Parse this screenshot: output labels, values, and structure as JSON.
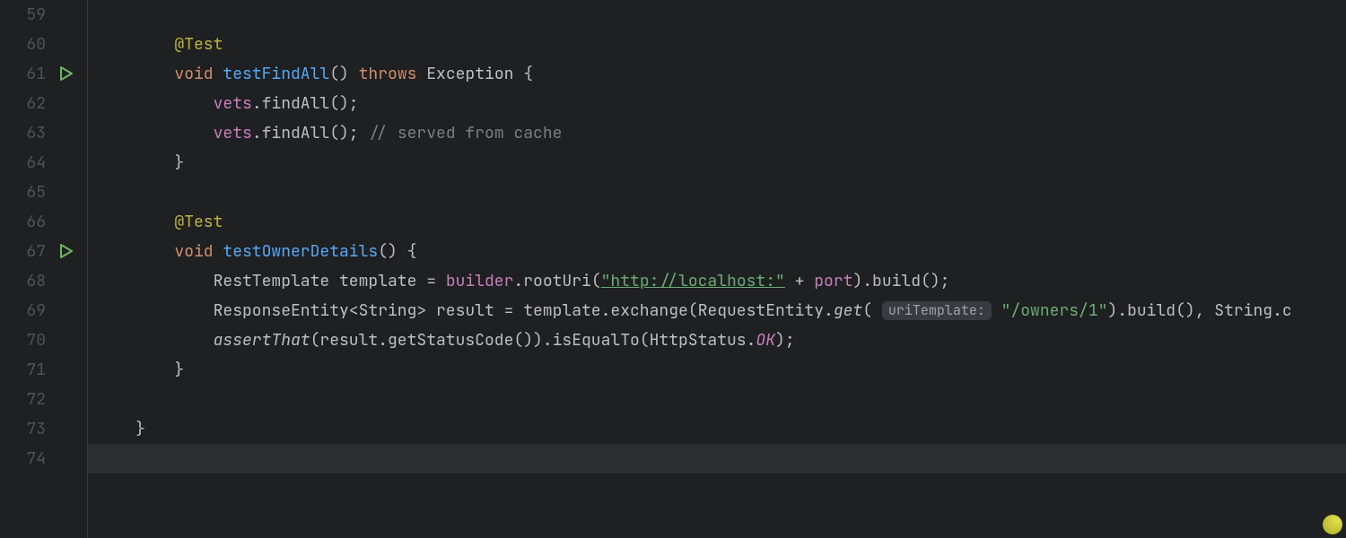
{
  "gutter": {
    "start": 59,
    "end": 74,
    "runnable_lines": [
      61,
      67
    ]
  },
  "current_line": 74,
  "code": {
    "59": [],
    "60": [
      {
        "indent": 8,
        "cls": "tk-annotation",
        "text": "@Test"
      }
    ],
    "61": [
      {
        "indent": 8,
        "cls": "tk-keyword",
        "text": "void "
      },
      {
        "cls": "tk-methoddecl",
        "text": "testFindAll"
      },
      {
        "cls": "tk-default",
        "text": "() "
      },
      {
        "cls": "tk-keyword",
        "text": "throws "
      },
      {
        "cls": "tk-type",
        "text": "Exception {"
      }
    ],
    "62": [
      {
        "indent": 12,
        "cls": "tk-field",
        "text": "vets"
      },
      {
        "cls": "tk-default",
        "text": ".findAll();"
      }
    ],
    "63": [
      {
        "indent": 12,
        "cls": "tk-field",
        "text": "vets"
      },
      {
        "cls": "tk-default",
        "text": ".findAll(); "
      },
      {
        "cls": "tk-comment",
        "text": "// served from cache"
      }
    ],
    "64": [
      {
        "indent": 8,
        "cls": "tk-default",
        "text": "}"
      }
    ],
    "65": [],
    "66": [
      {
        "indent": 8,
        "cls": "tk-annotation",
        "text": "@Test"
      }
    ],
    "67": [
      {
        "indent": 8,
        "cls": "tk-keyword",
        "text": "void "
      },
      {
        "cls": "tk-methoddecl",
        "text": "testOwnerDetails"
      },
      {
        "cls": "tk-default",
        "text": "() {"
      }
    ],
    "68": [
      {
        "indent": 12,
        "cls": "tk-type",
        "text": "RestTemplate template = "
      },
      {
        "cls": "tk-field",
        "text": "builder"
      },
      {
        "cls": "tk-default",
        "text": ".rootUri("
      },
      {
        "cls": "tk-link",
        "text": "\"http://localhost:\""
      },
      {
        "cls": "tk-default",
        "text": " + "
      },
      {
        "cls": "tk-field",
        "text": "port"
      },
      {
        "cls": "tk-default",
        "text": ").build();"
      }
    ],
    "69": [
      {
        "indent": 12,
        "cls": "tk-type",
        "text": "ResponseEntity<String> result = template.exchange(RequestEntity."
      },
      {
        "cls": "tk-staticcall",
        "text": "get"
      },
      {
        "cls": "tk-default",
        "text": "( "
      },
      {
        "hint": true,
        "text": "uriTemplate:"
      },
      {
        "cls": "tk-default",
        "text": " "
      },
      {
        "cls": "tk-string",
        "text": "\"/owners/1\""
      },
      {
        "cls": "tk-default",
        "text": ").build(), String.c"
      }
    ],
    "70": [
      {
        "indent": 12,
        "cls": "tk-staticcall",
        "text": "assertThat"
      },
      {
        "cls": "tk-default",
        "text": "(result.getStatusCode()).isEqualTo(HttpStatus."
      },
      {
        "cls": "tk-static",
        "text": "OK"
      },
      {
        "cls": "tk-default",
        "text": ");"
      }
    ],
    "71": [
      {
        "indent": 8,
        "cls": "tk-default",
        "text": "}"
      }
    ],
    "72": [],
    "73": [
      {
        "indent": 4,
        "cls": "tk-default",
        "text": "}"
      }
    ],
    "74": []
  }
}
